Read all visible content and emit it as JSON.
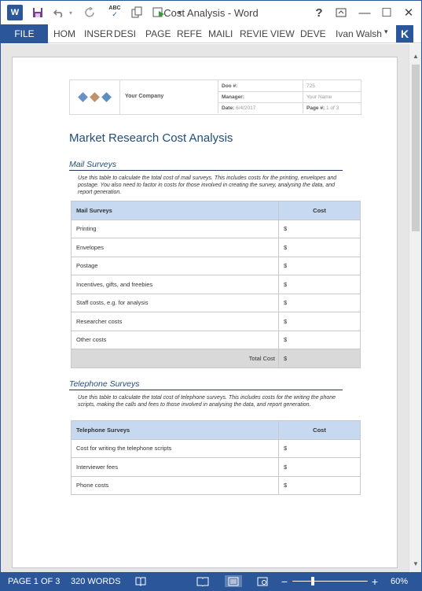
{
  "titlebar": {
    "title": "Cost Analysis - Word",
    "word_logo": "W",
    "icons": [
      "word-logo-icon",
      "save-icon",
      "undo-icon",
      "undo-dropdown-icon",
      "redo-icon",
      "spelling-abc-icon",
      "paste-format-icon",
      "macro-play-icon",
      "customize-qat-icon"
    ],
    "spelling_label": "ABC",
    "help": "?",
    "restore_symbol": "⧉",
    "minimize_symbol": "—",
    "maximize_symbol": "☐",
    "close_symbol": "✕"
  },
  "ribbon": {
    "file": "FILE",
    "tabs": [
      "HOM",
      "INSER",
      "DESI",
      "PAGE",
      "REFE",
      "MAILI",
      "REVIE",
      "VIEW",
      "DEVE"
    ],
    "user": "Ivan Walsh",
    "avatar": "K"
  },
  "document": {
    "header": {
      "company": "Your Company",
      "doc_no_label": "Doo  #:",
      "doc_no_value": "725",
      "manager_label": "Manager:",
      "manager_value": "Your Name",
      "date_label": "Date:",
      "date_value": "6/4/2017",
      "page_label": "Page  #:",
      "page_value": "1 of 3",
      "logo_colors": [
        "#6b8fc7",
        "#c0916b",
        "#5b8fc4"
      ]
    },
    "title": "Market Research Cost Analysis",
    "mail": {
      "heading": "Mail Surveys",
      "description": "Use this table to calculate the total cost of mail surveys. This includes costs for the printing, envelopes and postage. You also need to factor in costs for those involved in creating the survey, analysing the data, and report generation.",
      "col1": "Mail Surveys",
      "col2": "Cost",
      "rows": [
        "Printing",
        "Envelopes",
        "Postage",
        "Incentives, gifts, and freebies",
        "Staff costs, e.g. for analysis",
        "Researcher costs",
        "Other costs"
      ],
      "currency": "$",
      "total_label": "Total Cost",
      "total_value": "$"
    },
    "phone": {
      "heading": "Telephone Surveys",
      "description": "Use this table to calculate the total cost of telephone surveys. This includes costs for the writing the phone scripts, making the calls and fees to those involved in analysing the data, and report generation.",
      "col1": "Telephone Surveys",
      "col2": "Cost",
      "rows": [
        "Cost for writing the telephone scripts",
        "Interviewer fees",
        "Phone costs"
      ],
      "currency": "$"
    }
  },
  "statusbar": {
    "page": "PAGE 1 OF 3",
    "words": "320 WORDS",
    "zoom": "60%",
    "zoom_out": "−",
    "zoom_in": "+"
  },
  "colors": {
    "brand": "#2b579a",
    "heading": "#1f4e79",
    "table_header": "#c6d9f1",
    "total_row": "#d9d9d9"
  }
}
